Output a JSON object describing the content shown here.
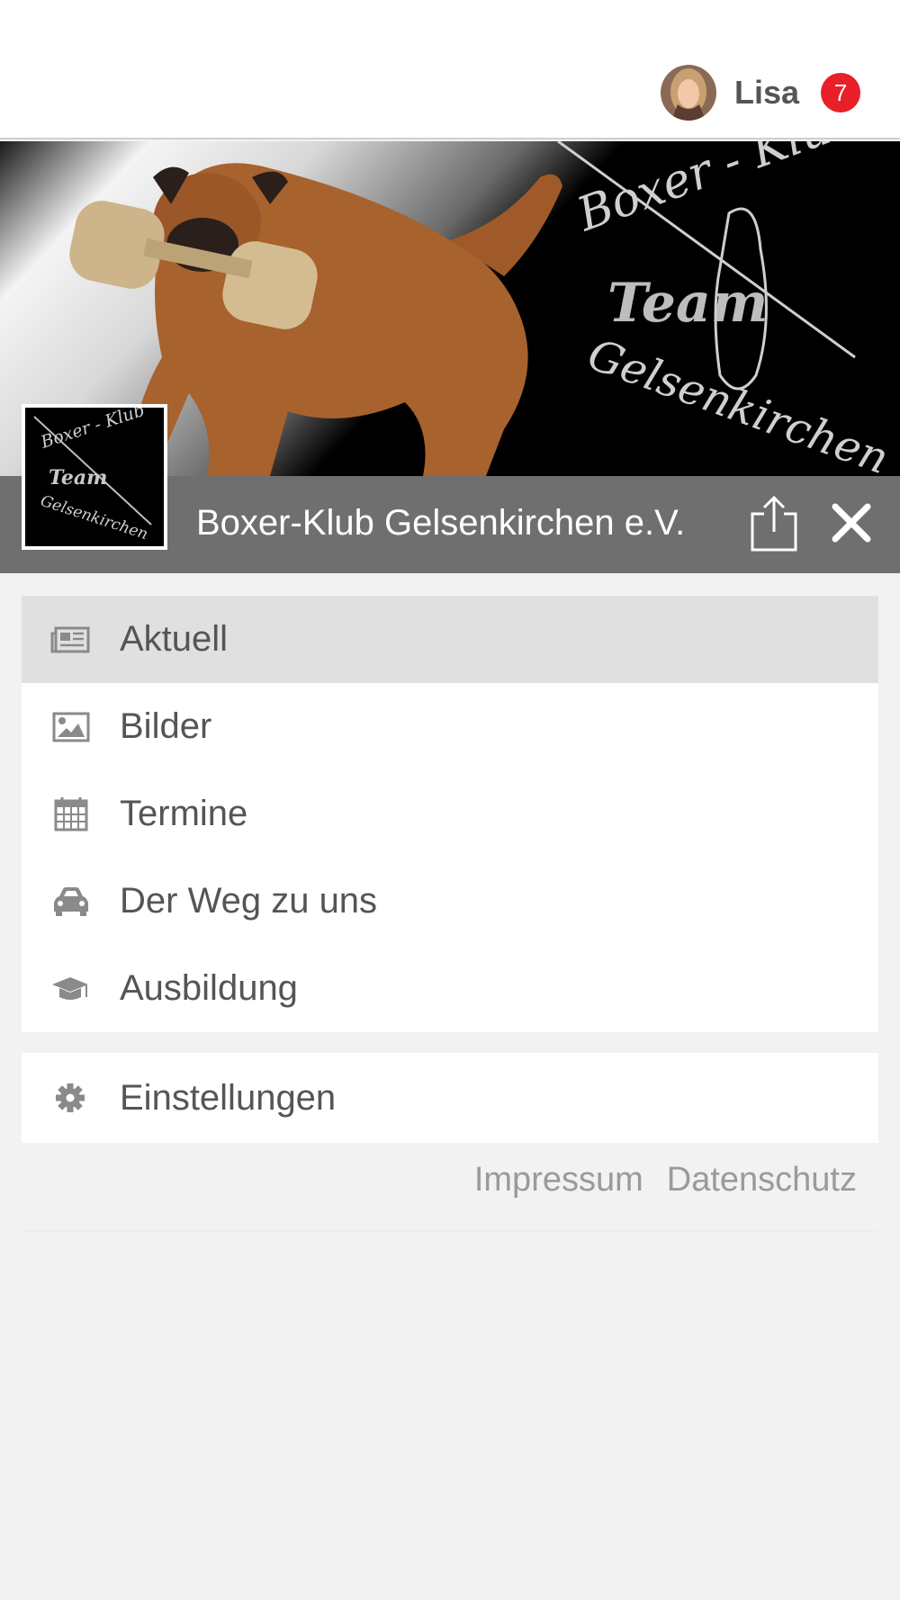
{
  "user": {
    "name": "Lisa",
    "notifications": "7"
  },
  "banner": {
    "logo_text_top": "Boxer - Klub",
    "logo_text_middle": "Team",
    "logo_text_bottom": "Gelsenkirchen"
  },
  "club": {
    "name": "Boxer-Klub Gelsenkirchen e.V."
  },
  "menu": {
    "items": [
      {
        "label": "Aktuell",
        "icon": "newspaper-icon",
        "active": true
      },
      {
        "label": "Bilder",
        "icon": "image-icon"
      },
      {
        "label": "Termine",
        "icon": "calendar-icon"
      },
      {
        "label": "Der Weg zu uns",
        "icon": "car-icon"
      },
      {
        "label": "Ausbildung",
        "icon": "graduation-cap-icon"
      }
    ]
  },
  "settings": {
    "label": "Einstellungen",
    "icon": "gear-icon"
  },
  "footer": {
    "impressum": "Impressum",
    "datenschutz": "Datenschutz"
  },
  "colors": {
    "badge": "#e8202a",
    "titlebar": "#6f6f6f",
    "active_item": "#e0e0e0"
  }
}
